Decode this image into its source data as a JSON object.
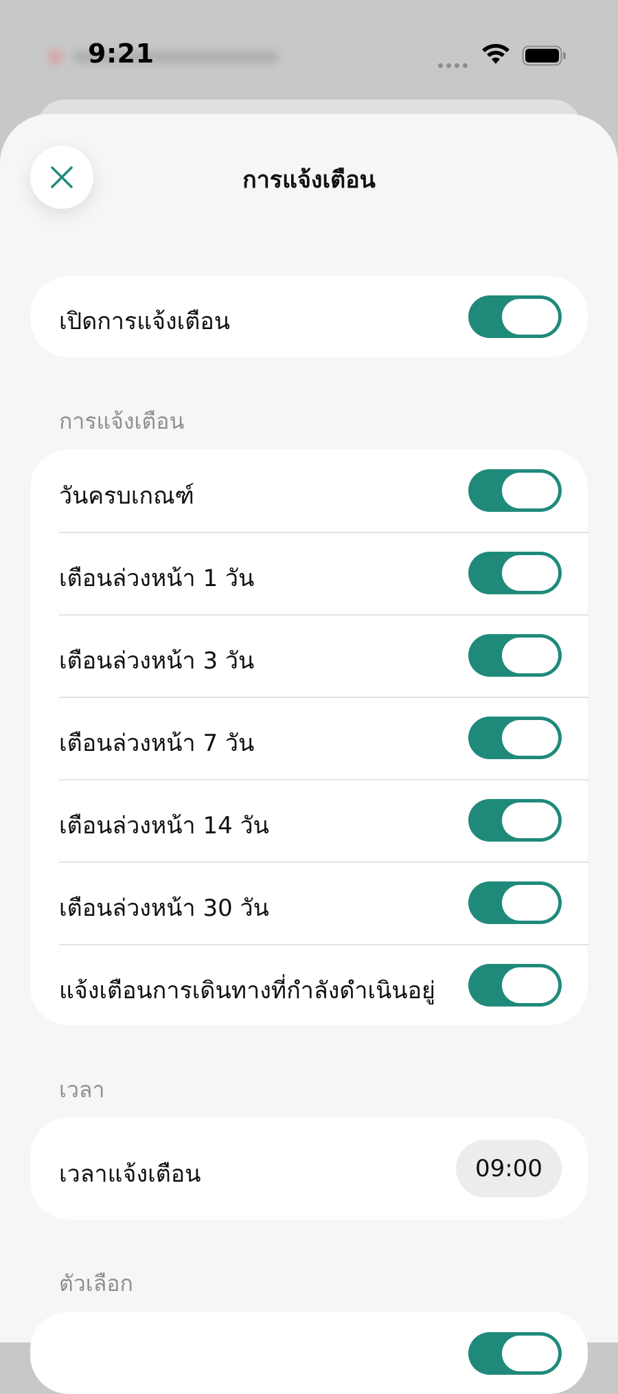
{
  "status_bar": {
    "time": "9:21",
    "signal_icon": "cellular-dots-icon",
    "wifi_icon": "wifi-icon",
    "battery_icon": "battery-icon"
  },
  "header": {
    "title": "การแจ้งเตือน",
    "close_icon": "close-icon"
  },
  "master": {
    "label": "เปิดการแจ้งเตือน",
    "on": true
  },
  "notifications_section": {
    "header": "การแจ้งเตือน",
    "items": [
      {
        "label": "วันครบเกณฑ์",
        "on": true
      },
      {
        "label": "เตือนล่วงหน้า 1 วัน",
        "on": true
      },
      {
        "label": "เตือนล่วงหน้า 3 วัน",
        "on": true
      },
      {
        "label": "เตือนล่วงหน้า 7 วัน",
        "on": true
      },
      {
        "label": "เตือนล่วงหน้า 14 วัน",
        "on": true
      },
      {
        "label": "เตือนล่วงหน้า 30 วัน",
        "on": true
      },
      {
        "label": "แจ้งเตือนการเดินทางที่กำลังดำเนินอยู่",
        "on": true
      }
    ]
  },
  "time_section": {
    "header": "เวลา",
    "label": "เวลาแจ้งเตือน",
    "value": "09:00"
  },
  "options_section": {
    "header": "ตัวเลือก"
  },
  "colors": {
    "accent": "#1f8a7a",
    "sheet_background": "#f5f6f6",
    "card_background": "#ffffff",
    "section_header": "#8e9090"
  }
}
